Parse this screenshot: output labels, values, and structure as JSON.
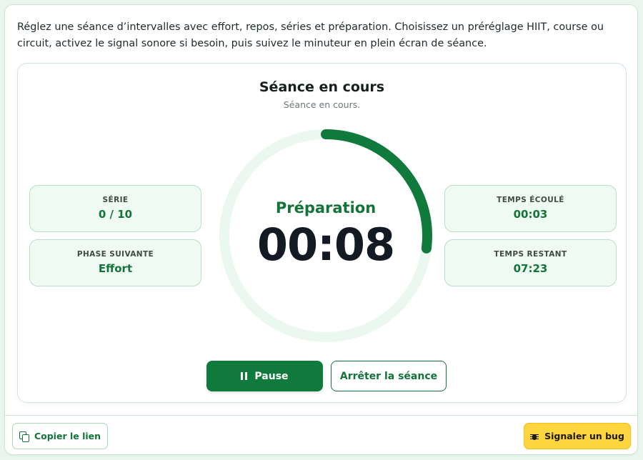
{
  "intro_text": "Réglez une séance d’intervalles avec effort, repos, séries et préparation. Choisissez un préréglage HIIT, course ou circuit, activez le signal sonore si besoin, puis suivez le minuteur en plein écran de séance.",
  "session": {
    "title": "Séance en cours",
    "subtitle": "Séance en cours.",
    "phase": "Préparation",
    "time": "00:08",
    "progress": 0.27
  },
  "stats": {
    "serie": {
      "label": "Série",
      "value": "0 / 10"
    },
    "phase_suivante": {
      "label": "Phase suivante",
      "value": "Effort"
    },
    "temps_ecoule": {
      "label": "Temps écoulé",
      "value": "00:03"
    },
    "temps_restant": {
      "label": "Temps restant",
      "value": "07:23"
    }
  },
  "buttons": {
    "pause": "Pause",
    "stop": "Arrêter la séance",
    "copy_link": "Copier le lien",
    "report_bug": "Signaler un bug"
  },
  "icons": {
    "pause": "pause-icon",
    "copy": "copy-icon",
    "bug": "bug-icon"
  },
  "colors": {
    "accent": "#0f7a3c",
    "ring_track": "#eaf8ef",
    "bug_button": "#fdd53e"
  }
}
